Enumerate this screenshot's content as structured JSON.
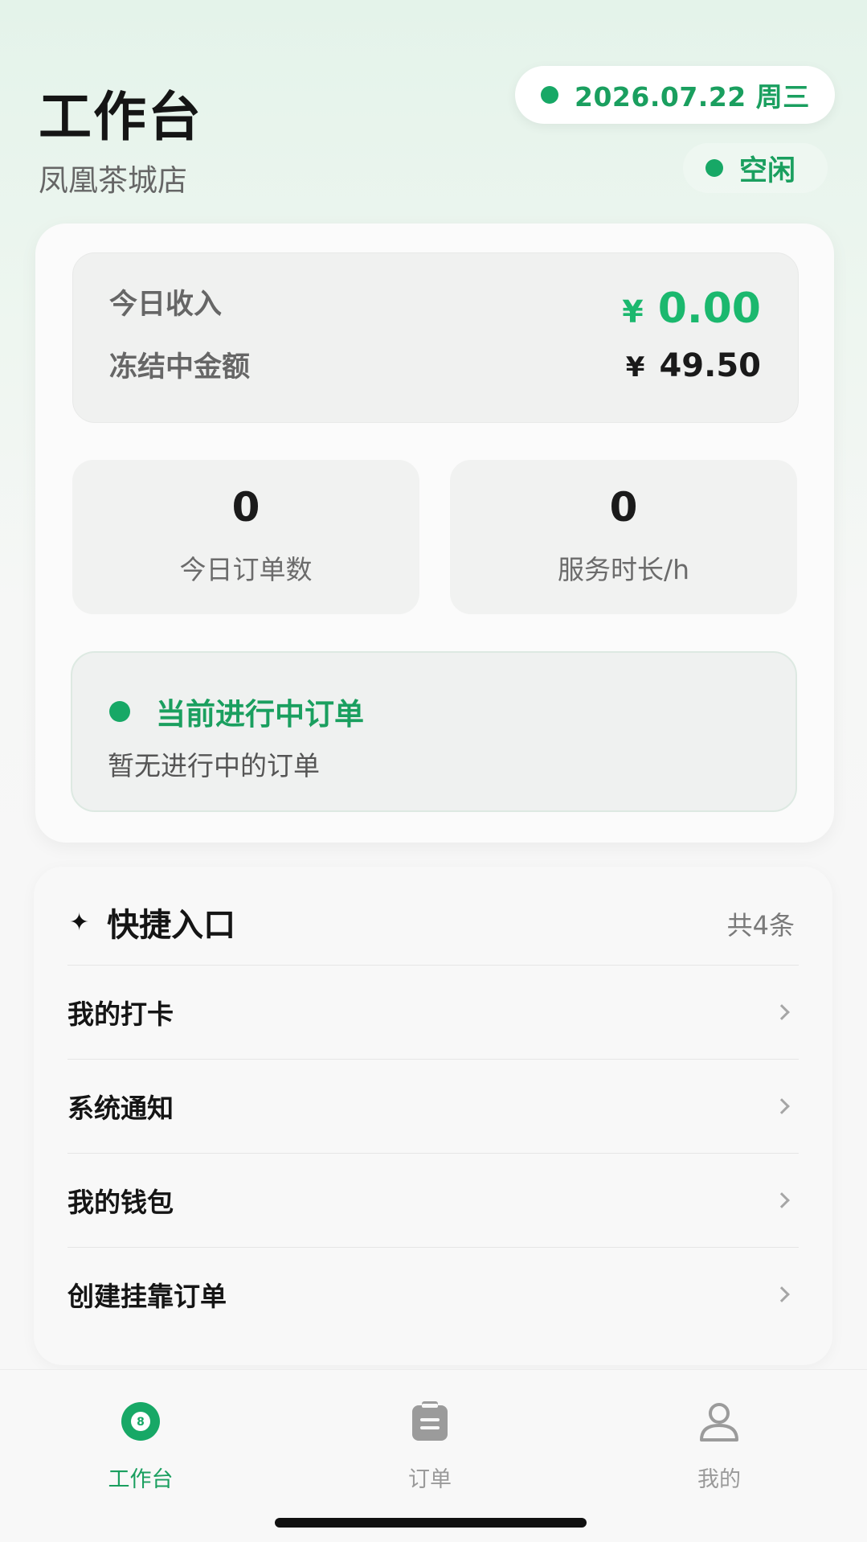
{
  "header": {
    "title": "工作台",
    "store": "凤凰茶城店",
    "date": "2026.07.22 周三",
    "status": "空闲"
  },
  "income": {
    "today_label": "今日收入",
    "today_currency": "¥",
    "today_value": "0.00",
    "frozen_label": "冻结中金额",
    "frozen_currency": "¥",
    "frozen_value": "49.50"
  },
  "stats": [
    {
      "value": "0",
      "label": "今日订单数"
    },
    {
      "value": "0",
      "label": "服务时长/h"
    }
  ],
  "current_order": {
    "title": "当前进行中订单",
    "empty_text": "暂无进行中的订单"
  },
  "quick": {
    "title": "快捷入口",
    "count": "共4条",
    "items": [
      {
        "label": "我的打卡"
      },
      {
        "label": "系统通知"
      },
      {
        "label": "我的钱包"
      },
      {
        "label": "创建挂靠订单"
      }
    ]
  },
  "nav": {
    "items": [
      {
        "label": "工作台",
        "icon": "billiard-ball-icon",
        "active": true
      },
      {
        "label": "订单",
        "icon": "clipboard-icon",
        "active": false
      },
      {
        "label": "我的",
        "icon": "user-icon",
        "active": false
      }
    ]
  },
  "colors": {
    "accent": "#1a9f5f",
    "accent_bright": "#1bb86e"
  }
}
